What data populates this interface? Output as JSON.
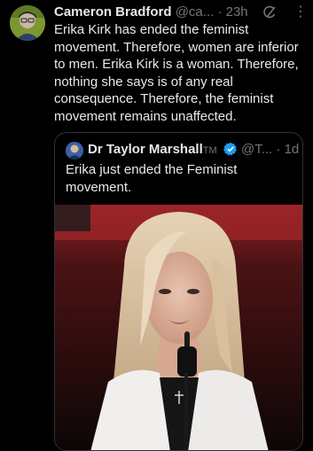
{
  "tweet": {
    "author_name": "Cameron Bradford",
    "handle": "@ca...",
    "separator": "·",
    "time": "23h",
    "text": "Erika Kirk has ended the feminist movement. Therefore, women are inferior to men. Erika Kirk is a woman. Therefore, nothing she says is of any real consequence. Therefore, the feminist movement remains unaffected.",
    "grok_icon": "grok-icon",
    "more_icon": "more-options-icon"
  },
  "quoted_tweet": {
    "author_name": "Dr Taylor Marshall",
    "tm": "TM",
    "verified_icon": "verified-badge-icon",
    "handle": "@T...",
    "separator": "·",
    "time": "1d",
    "text": "Erika just ended the Feminist movement."
  },
  "colors": {
    "background": "#000000",
    "primary_text": "#e7e9ea",
    "secondary_text": "#71767b",
    "verified_blue": "#1d9bf0",
    "border": "#2f3336"
  }
}
